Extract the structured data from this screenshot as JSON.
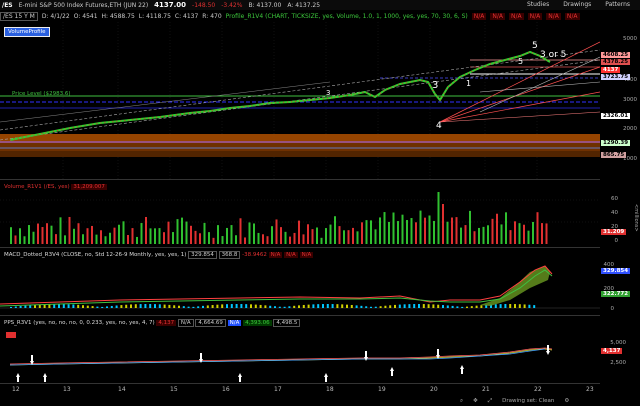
{
  "header": {
    "symbol": "/ES",
    "description": "E-mini S&P 500 Index Futures,ETH (JUN 22)",
    "last_price": "4137.00",
    "change": "-148.50",
    "change_pct": "-3.42%",
    "bid": "B: 4137.00",
    "ask": "A: 4137.25",
    "toolbar": [
      "Studies",
      "Drawings",
      "Patterns"
    ]
  },
  "subheader": {
    "timeframe": "/ES 15 Y M",
    "date": "D: 4/1/22",
    "open": "O: 4541",
    "high": "H: 4588.75",
    "low": "L: 4118.75",
    "close": "C: 4137",
    "range": "R: 470",
    "study": "Profile_R1V4 (CHART, TICKSIZE, yes, Volume, 1.0, 1, 1000, yes, yes, 70, 30, 6, S)",
    "na": [
      "N/A",
      "N/A",
      "N/A",
      "N/A",
      "N/A",
      "N/A"
    ]
  },
  "price_panel": {
    "volume_profile_label": "VolumeProfile",
    "level_label": "Price Level ($2983.6)",
    "wave_labels": [
      "3",
      "3",
      "1",
      "4",
      "5",
      "3 or 5",
      "5"
    ],
    "y_labels": [
      "5000",
      "4000",
      "3000",
      "2000",
      "1000"
    ],
    "tags": [
      {
        "text": "4608.25",
        "color": "#ff9a9a"
      },
      {
        "text": "4378.25",
        "color": "#e05050"
      },
      {
        "text": "4137",
        "color": "#ff3030"
      },
      {
        "text": "3723.75",
        "color": "#d0d0ff"
      },
      {
        "text": "2326.01",
        "color": "#ffffff"
      },
      {
        "text": "1290.39",
        "color": "#ccffcc"
      },
      {
        "text": "865.75",
        "color": "#d0a0a0"
      }
    ]
  },
  "volume_panel": {
    "label": "Volume_R1V1 (/ES, yes)",
    "value_tag": "31,209.007",
    "y_labels": [
      "60",
      "40",
      "20",
      "0"
    ],
    "unit": "<millions>",
    "last_tag": "31.209"
  },
  "macd_panel": {
    "label": "MACD_Dotted_R3V4 (CLOSE, no, Std 12-26-9 Monthly, yes, yes, 1)",
    "values": [
      "329.854",
      "368.8",
      "-38.9462"
    ],
    "na": [
      "N/A",
      "N/A",
      "N/A"
    ],
    "y_labels": [
      "400",
      "200",
      "0"
    ],
    "tags": [
      "329.854",
      "322.772"
    ]
  },
  "pps_panel": {
    "label": "PPS_R3V1 (yes, no, no, no, 0, 0.233, yes, no, yes, 4, 7)",
    "values": [
      "4,137",
      "N/A",
      "4,664.69",
      "N/A",
      "4,393.06",
      "4,498.5"
    ],
    "y_labels": [
      "5,000",
      "2,500"
    ],
    "tags": [
      "4,137"
    ]
  },
  "x_axis": [
    "12",
    "13",
    "14",
    "15",
    "16",
    "17",
    "18",
    "19",
    "20",
    "21",
    "22",
    "23"
  ],
  "footer": {
    "drawing_set": "Drawing set: Clean"
  }
}
